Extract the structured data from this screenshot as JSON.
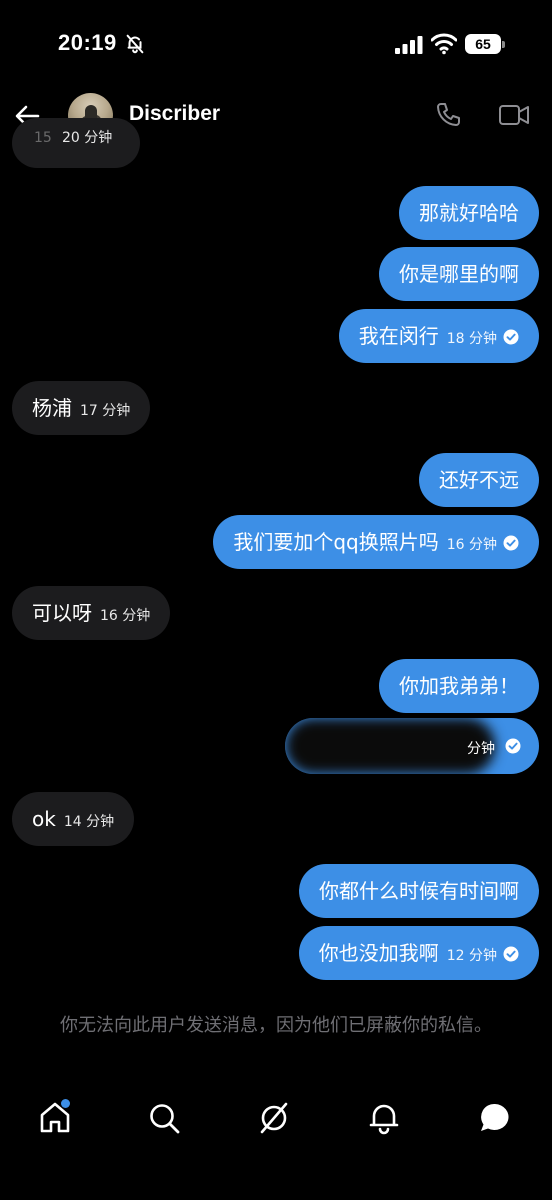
{
  "status_bar": {
    "time": "20:19",
    "battery": "65"
  },
  "header": {
    "contact_name": "Discriber"
  },
  "messages": [
    {
      "side": "recv",
      "text": "15",
      "time": "20 分钟",
      "partial": true
    },
    {
      "side": "sent",
      "text": "那就好哈哈",
      "time": ""
    },
    {
      "side": "sent",
      "text": "你是哪里的啊",
      "time": ""
    },
    {
      "side": "sent",
      "text": "我在闵行",
      "time": "18 分钟"
    },
    {
      "side": "recv",
      "text": "杨浦",
      "time": "17 分钟"
    },
    {
      "side": "sent",
      "text": "还好不远",
      "time": ""
    },
    {
      "side": "sent",
      "text": "我们要加个qq换照片吗",
      "time": "16 分钟"
    },
    {
      "side": "recv",
      "text": "可以呀",
      "time": "16 分钟"
    },
    {
      "side": "sent",
      "text": "你加我弟弟！",
      "time": ""
    },
    {
      "side": "sent",
      "text": "",
      "time": "分钟",
      "blurred": true
    },
    {
      "side": "recv",
      "text": "ok",
      "time": "14 分钟"
    },
    {
      "side": "sent",
      "text": "你都什么时候有时间啊",
      "time": ""
    },
    {
      "side": "sent",
      "text": "你也没加我啊",
      "time": "12 分钟"
    }
  ],
  "blocked_note": "你无法向此用户发送消息，因为他们已屏蔽你的私信。",
  "nav": {
    "items": [
      "home-icon",
      "search-icon",
      "explore-icon",
      "notifications-icon",
      "messages-icon"
    ]
  },
  "colors": {
    "sent_bubble": "#3d8fe6",
    "recv_bubble": "#1c1c1e",
    "background": "#000000"
  }
}
